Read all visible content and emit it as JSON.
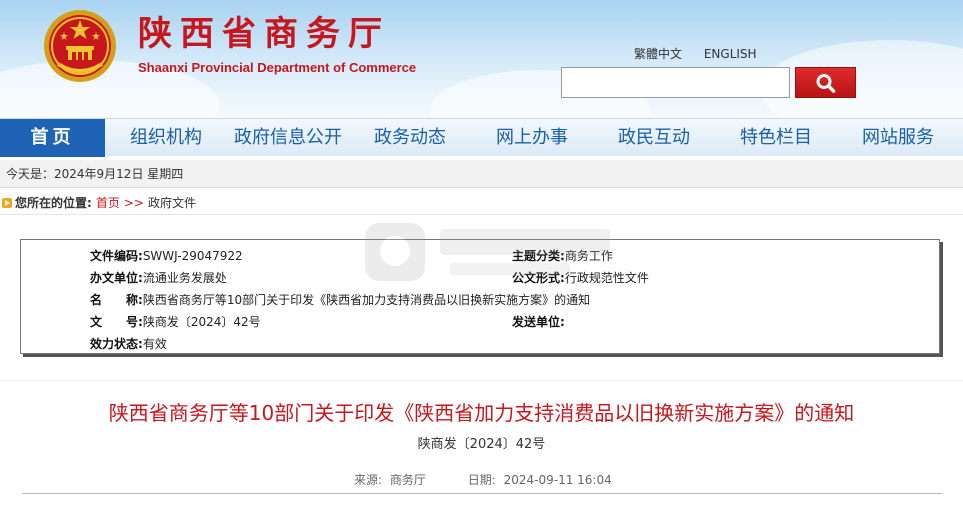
{
  "header": {
    "title_cn": "陕西省商务厅",
    "title_en": "Shaanxi Provincial Department of Commerce",
    "lang_traditional": "繁體中文",
    "lang_english": "ENGLISH",
    "search_placeholder": "",
    "search_icon": "search-icon",
    "emblem_icon": "national-emblem-icon"
  },
  "nav": {
    "items": [
      "首页",
      "组织机构",
      "政府信息公开",
      "政务动态",
      "网上办事",
      "政民互动",
      "特色栏目",
      "网站服务"
    ]
  },
  "date_bar": {
    "text": "今天是：2024年9月12日 星期四"
  },
  "breadcrumb": {
    "label": "您所在的位置:",
    "home": "首页",
    "separator": ">>",
    "current": "政府文件"
  },
  "info": {
    "doc_code_label": "文件编码:",
    "doc_code": "SWWJ-29047922",
    "office_label": "办文单位:",
    "office": "流通业务发展处",
    "name_label": "名　　称:",
    "name": "陕西省商务厅等10部门关于印发《陕西省加力支持消费品以旧换新实施方案》的通知",
    "number_label": "文　　号:",
    "number": "陕商发〔2024〕42号",
    "status_label": "效力状态:",
    "status": "有效",
    "category_label": "主题分类:",
    "category": "商务工作",
    "public_label": "公文形式:",
    "public": "行政规范性文件",
    "sender_label": "发送单位:",
    "sender": ""
  },
  "article": {
    "title": "陕西省商务厅等10部门关于印发《陕西省加力支持消费品以旧换新实施方案》的通知",
    "doc_no": "陕商发〔2024〕42号",
    "source_label": "来源:",
    "source": "商务厅",
    "date_label": "日期:",
    "date": "2024-09-11 16:04"
  },
  "colors": {
    "brand_red": "#c8161d",
    "nav_blue": "#1e63b6",
    "nav_text": "#1a5fa8"
  }
}
